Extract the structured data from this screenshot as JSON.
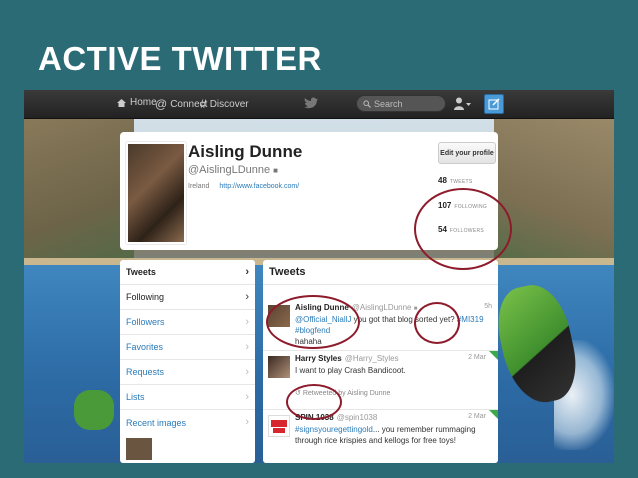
{
  "slide_title": "ACTIVE TWITTER",
  "topbar": {
    "home": "Home",
    "connect": "Connect",
    "discover": "Discover",
    "search_placeholder": "Search"
  },
  "profile": {
    "name": "Aisling Dunne",
    "handle": "@AislingLDunne",
    "location": "Ireland",
    "url": "http://www.facebook.com/",
    "edit_button": "Edit your profile",
    "stats": [
      {
        "value": "48",
        "label": "TWEETS"
      },
      {
        "value": "107",
        "label": "FOLLOWING"
      },
      {
        "value": "54",
        "label": "FOLLOWERS"
      }
    ]
  },
  "sidenav": {
    "items": [
      {
        "label": "Tweets"
      },
      {
        "label": "Following"
      },
      {
        "label": "Followers"
      },
      {
        "label": "Favorites"
      },
      {
        "label": "Requests"
      },
      {
        "label": "Lists"
      },
      {
        "label": "Recent images"
      }
    ]
  },
  "tweets": {
    "header": "Tweets",
    "items": [
      {
        "name": "Aisling Dunne",
        "handle": "@AislingLDunne",
        "time": "5h",
        "mention": "@Official_NiallJ",
        "text": " you got that blog sorted yet? ",
        "hashtags": "#MI319 #blogfend",
        "text2": "hahaha"
      },
      {
        "name": "Harry Styles",
        "handle": "@Harry_Styles",
        "time": "2 Mar",
        "text": "I want to play Crash Bandicoot.",
        "retweet": "Retweeted by Aisling Dunne"
      },
      {
        "name": "SPIN 1038",
        "handle": "@spin1038",
        "time": "2 Mar",
        "hashtag": "#signsyouregettingold",
        "text": "... you remember rummaging through rice krispies and kellogs for free toys!"
      }
    ]
  },
  "colors": {
    "slide_bg": "#2b6b75",
    "link": "#2b7bb9",
    "annotation": "#8e1b2b"
  }
}
